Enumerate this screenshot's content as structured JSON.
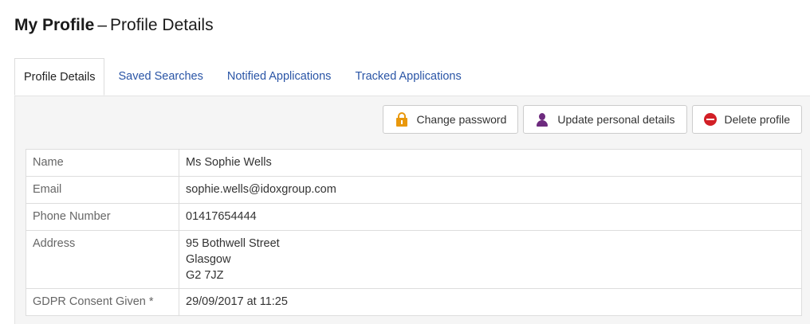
{
  "page": {
    "title_main": "My Profile",
    "title_sep": "–",
    "title_sub": "Profile Details"
  },
  "tabs": [
    {
      "label": "Profile Details",
      "active": true
    },
    {
      "label": "Saved Searches",
      "active": false
    },
    {
      "label": "Notified Applications",
      "active": false
    },
    {
      "label": "Tracked Applications",
      "active": false
    }
  ],
  "toolbar": {
    "change_password": {
      "label": "Change password",
      "icon": "lock-icon",
      "icon_color": "#e9980c"
    },
    "update_details": {
      "label": "Update personal details",
      "icon": "user-icon",
      "icon_color": "#6d2a7e"
    },
    "delete_profile": {
      "label": "Delete profile",
      "icon": "minus-circle-icon",
      "icon_color": "#d21f26"
    }
  },
  "profile": {
    "name": {
      "label": "Name",
      "value": "Ms Sophie Wells"
    },
    "email": {
      "label": "Email",
      "value": "sophie.wells@idoxgroup.com"
    },
    "phone": {
      "label": "Phone Number",
      "value": "01417654444"
    },
    "address": {
      "label": "Address",
      "lines": [
        "95 Bothwell Street",
        "Glasgow",
        "G2 7JZ"
      ]
    },
    "gdpr": {
      "label": "GDPR Consent Given *",
      "value": "29/09/2017 at 11:25"
    }
  },
  "colors": {
    "link": "#2a55a6",
    "panel_bg": "#f5f5f5"
  }
}
